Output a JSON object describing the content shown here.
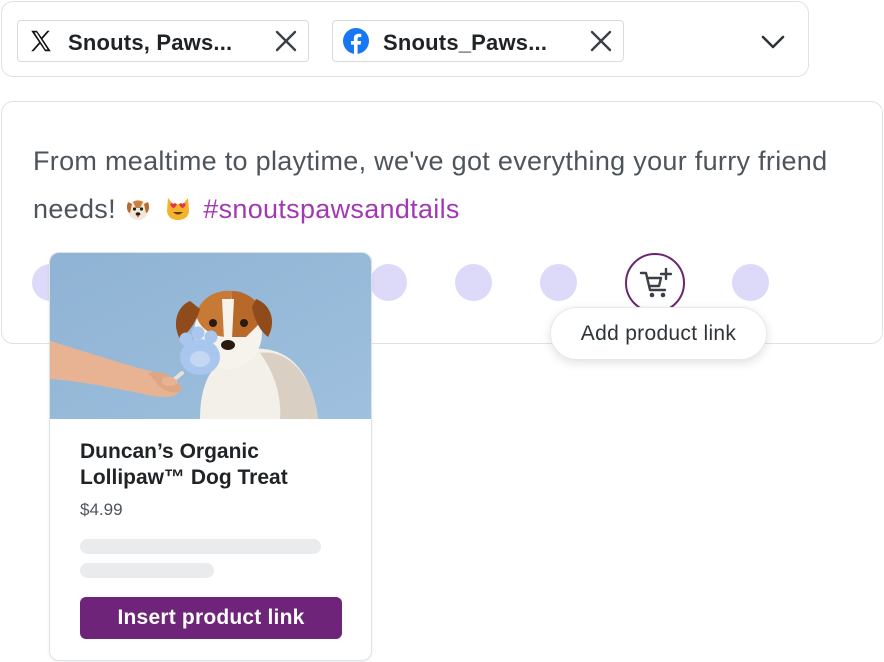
{
  "account_selector": {
    "chips": [
      {
        "network": "x",
        "icon": "x-logo-icon",
        "label": "Snouts, Paws..."
      },
      {
        "network": "facebook",
        "icon": "facebook-logo-icon",
        "label": "Snouts_Paws..."
      }
    ],
    "expand_icon": "chevron-down-icon"
  },
  "composer": {
    "text_main": "From mealtime to playtime, we've got everything your furry friend needs!",
    "emojis": [
      "dog-face-emoji",
      "heart-eyes-cat-emoji"
    ],
    "hashtag": "#snoutspawsandtails",
    "hashtag_color": "#a239b3"
  },
  "toolbar": {
    "cart_icon": "add-to-cart-icon",
    "tooltip": "Add product link"
  },
  "product_card": {
    "image": "dog-with-paw-treat-photo",
    "name_line1": "Duncan’s Organic",
    "name_line2": "Lollipaw™ Dog Treat",
    "price": "$4.99",
    "insert_button": "Insert product link",
    "accent": "#6e2478"
  },
  "colors": {
    "border": "#dfe2e5",
    "dot": "#dcd9f9",
    "cart_ring": "#6b2670"
  }
}
